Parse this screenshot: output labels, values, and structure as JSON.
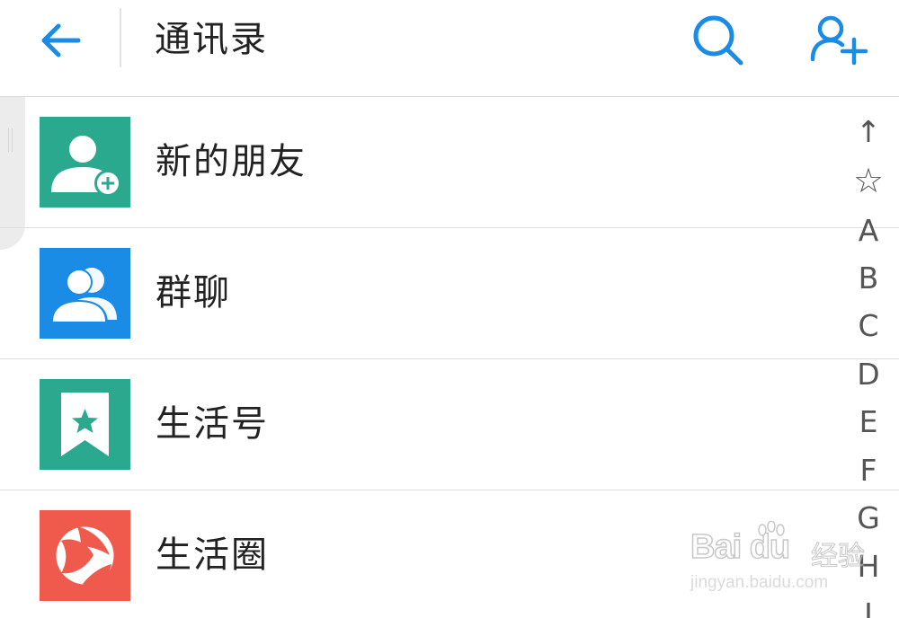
{
  "header": {
    "title": "通讯录",
    "back_icon": "arrow-left-icon",
    "search_icon": "search-icon",
    "add_icon": "add-contact-icon",
    "accent_color": "#1a8ce6"
  },
  "list": {
    "items": [
      {
        "label": "新的朋友",
        "icon": "new-friend-icon",
        "color": "#2aa98f"
      },
      {
        "label": "群聊",
        "icon": "group-chat-icon",
        "color": "#1a8ce6"
      },
      {
        "label": "生活号",
        "icon": "bookmark-star-icon",
        "color": "#2aa98f"
      },
      {
        "label": "生活圈",
        "icon": "life-circle-icon",
        "color": "#f05a4d"
      }
    ]
  },
  "alpha_index": [
    "↑",
    "☆",
    "A",
    "B",
    "C",
    "D",
    "E",
    "F",
    "G",
    "H",
    "I"
  ],
  "watermark": {
    "brand": "Bai du",
    "brand_cn": "经验",
    "url": "jingyan.baidu.com"
  }
}
